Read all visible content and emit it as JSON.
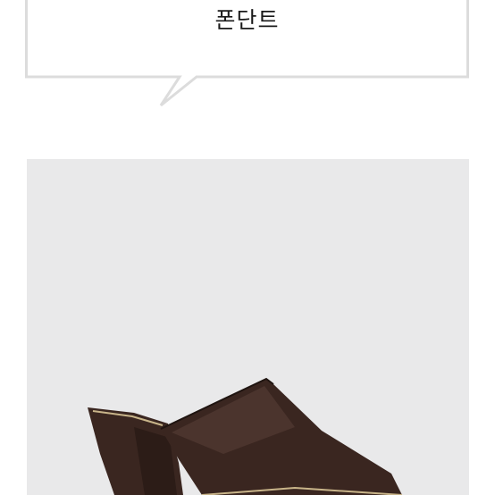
{
  "speech_bubble": {
    "label": "폰단트"
  },
  "product_photo": {
    "subject": "mule-sandal-icon",
    "colors": {
      "background": "#e9e9ea",
      "shoe": "#3a2620",
      "shoe_highlight": "#5a4038",
      "sole_edge": "#c9b58a"
    }
  }
}
